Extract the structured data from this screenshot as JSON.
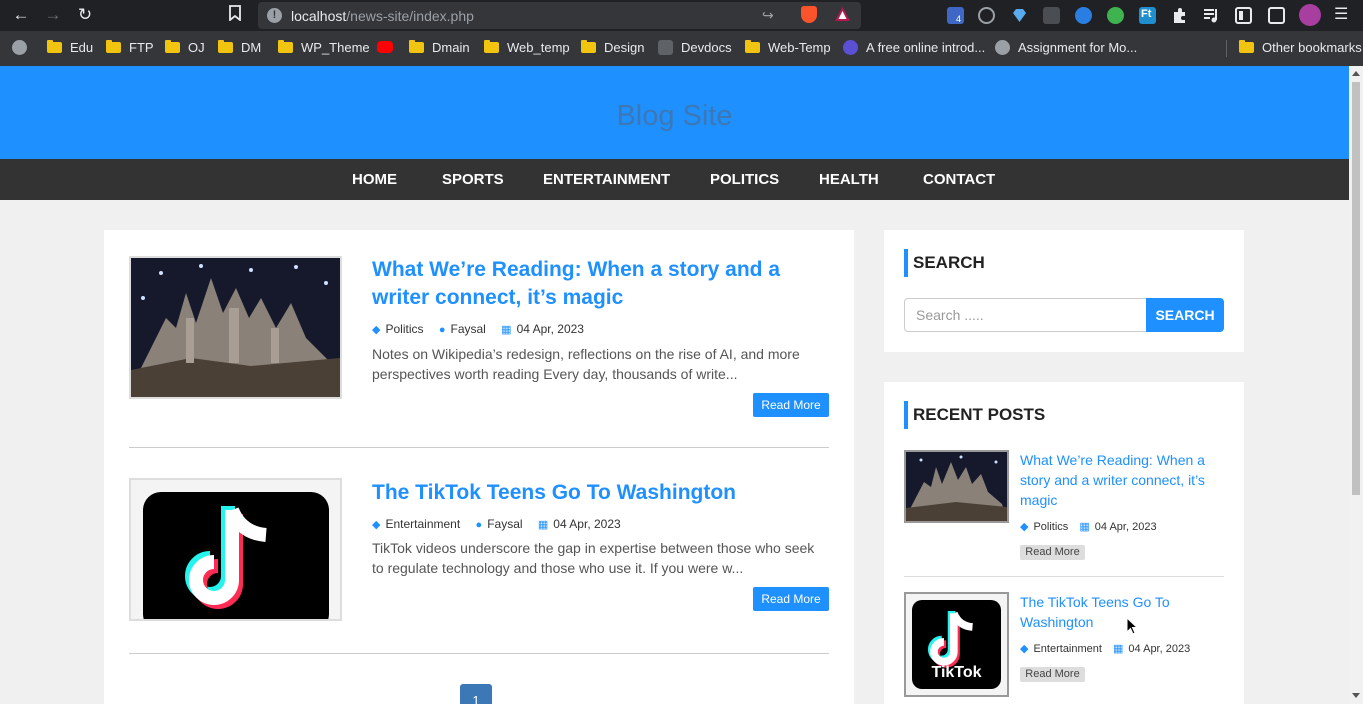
{
  "browser": {
    "url_host": "localhost",
    "url_path": "/news-site/index.php",
    "bookmarks": [
      "Edu",
      "FTP",
      "OJ",
      "DM",
      "WP_Theme",
      "Dmain",
      "Web_temp",
      "Design",
      "Devdocs",
      "Web-Temp",
      "A free online introd...",
      "Assignment for Mo...",
      "Other bookmarks"
    ],
    "extension_badge": "4",
    "ext_ft_label": "Ft"
  },
  "site": {
    "title": "Blog Site",
    "nav": [
      "HOME",
      "SPORTS",
      "ENTERTAINMENT",
      "POLITICS",
      "HEALTH",
      "CONTACT"
    ]
  },
  "posts": [
    {
      "title_line1": "What We’re Reading: When a story and a",
      "title_line2": "writer connect, it’s magic",
      "category": "Politics",
      "author": "Faysal",
      "date": "04 Apr, 2023",
      "excerpt": "Notes on Wikipedia’s redesign, reflections on the rise of AI, and more perspectives worth reading Every day, thousands of write...",
      "read_more": "Read More"
    },
    {
      "title": "The TikTok Teens Go To Washington",
      "category": "Entertainment",
      "author": "Faysal",
      "date": "04 Apr, 2023",
      "excerpt": "TikTok videos underscore the gap in expertise between those who seek to regulate technology and those who use it. If you were w...",
      "read_more": "Read More"
    }
  ],
  "pagination": {
    "current": "1"
  },
  "sidebar": {
    "search": {
      "heading": "SEARCH",
      "placeholder": "Search .....",
      "button": "SEARCH"
    },
    "recent": {
      "heading": "RECENT POSTS",
      "items": [
        {
          "title": "What We’re Reading: When a story and a writer connect, it’s magic",
          "category": "Politics",
          "date": "04 Apr, 2023",
          "read_more": "Read More"
        },
        {
          "title": "The TikTok Teens Go To Washington",
          "category": "Entertainment",
          "date": "04 Apr, 2023",
          "read_more": "Read More",
          "thumb_label": "TikTok"
        }
      ]
    }
  }
}
